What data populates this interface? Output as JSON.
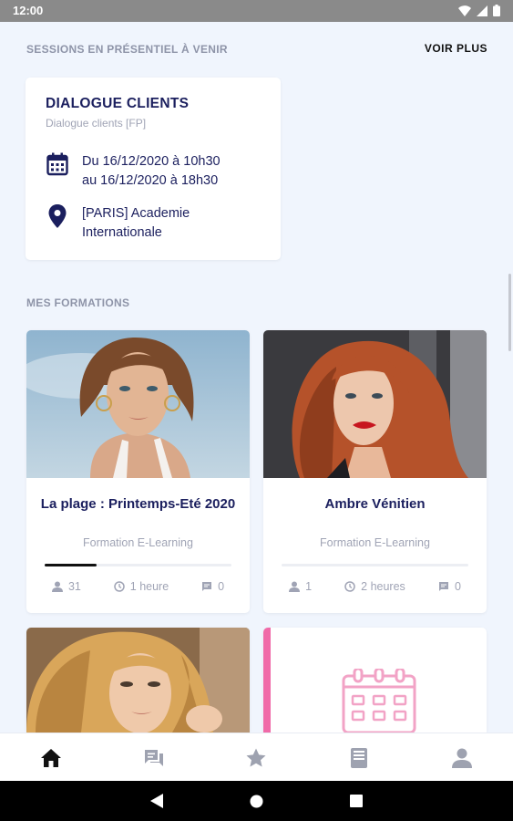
{
  "status_bar": {
    "time": "12:00"
  },
  "upcoming": {
    "heading": "SESSIONS EN PRÉSENTIEL À VENIR",
    "more_label": "VOIR PLUS",
    "session": {
      "title": "DIALOGUE CLIENTS",
      "subtitle": "Dialogue clients [FP]",
      "date_line1": "Du 16/12/2020 à 10h30",
      "date_line2": "au 16/12/2020 à 18h30",
      "location_line1": "[PARIS] Academie",
      "location_line2": "Internationale"
    }
  },
  "formations": {
    "heading": "MES FORMATIONS",
    "courses": [
      {
        "title": "La plage : Printemps-Eté 2020",
        "type": "Formation E-Learning",
        "learners": "31",
        "duration": "1 heure",
        "comments": "0",
        "progress": 0.28
      },
      {
        "title": "Ambre Vénitien",
        "type": "Formation E-Learning",
        "learners": "1",
        "duration": "2 heures",
        "comments": "0",
        "progress": 0
      }
    ]
  },
  "colors": {
    "accent": "#1b1f5e",
    "pink_accent": "#f06aa8",
    "muted": "#a0a4b5"
  },
  "bottom_nav": [
    "home-icon",
    "chat-icon",
    "star-icon",
    "book-icon",
    "person-icon"
  ]
}
